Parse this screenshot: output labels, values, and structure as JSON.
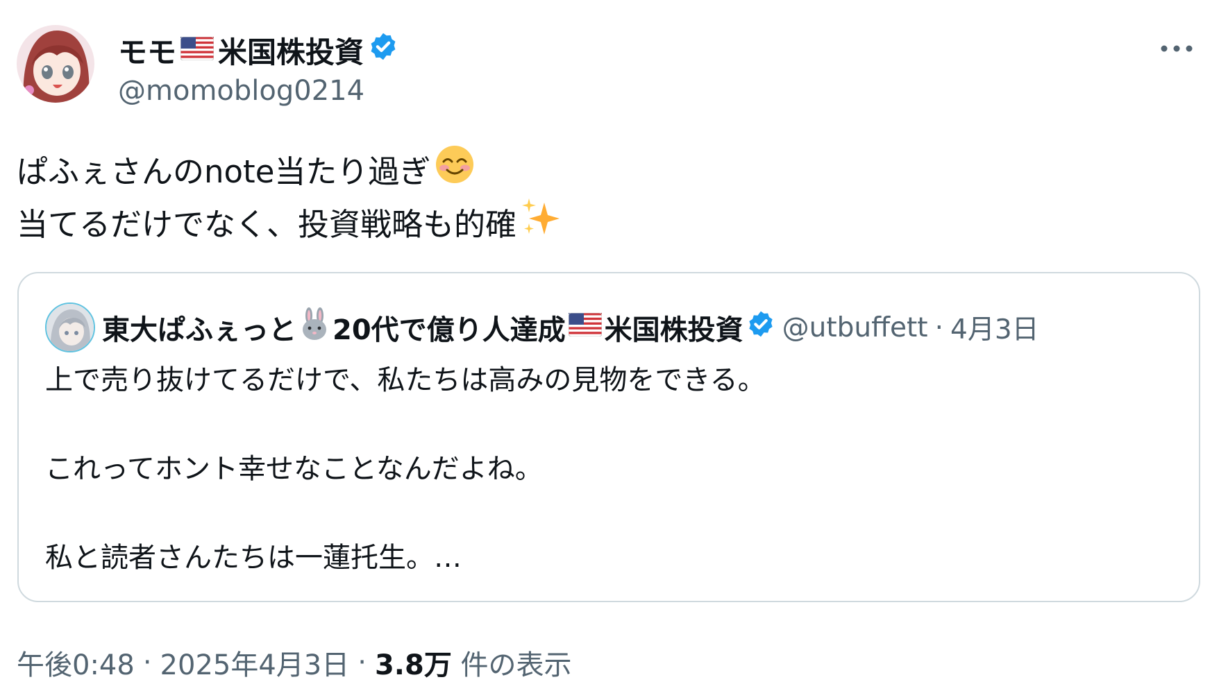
{
  "author": {
    "display_name": "モモ",
    "display_name_suffix": "米国株投資",
    "handle": "@momoblog0214",
    "verified_color": "#1d9bf0"
  },
  "tweet": {
    "line1": "ぱふぇさんのnote当たり過ぎ",
    "line2": "当てるだけでなく、投資戦略も的確",
    "emoji1": "smiling-face-icon",
    "emoji2": "sparkles-icon"
  },
  "quote": {
    "display_name": "東大ぱふぇっと",
    "display_name_mid": "20代で億り人達成",
    "display_name_suffix": "米国株投資",
    "handle": "@utbuffett",
    "separator": "·",
    "date": "4月3日",
    "paragraphs": [
      "上で売り抜けてるだけで、私たちは高みの見物をできる。",
      "これってホント幸せなことなんだよね。",
      "私と読者さんたちは一蓮托生。…"
    ]
  },
  "meta": {
    "time": "午後0:48",
    "sep1": "·",
    "date": "2025年4月3日",
    "sep2": "·",
    "views_count": "3.8万",
    "views_label": "件の表示"
  },
  "colors": {
    "text": "#0f1419",
    "muted": "#536471",
    "border": "#cfd9de",
    "verified": "#1d9bf0"
  }
}
